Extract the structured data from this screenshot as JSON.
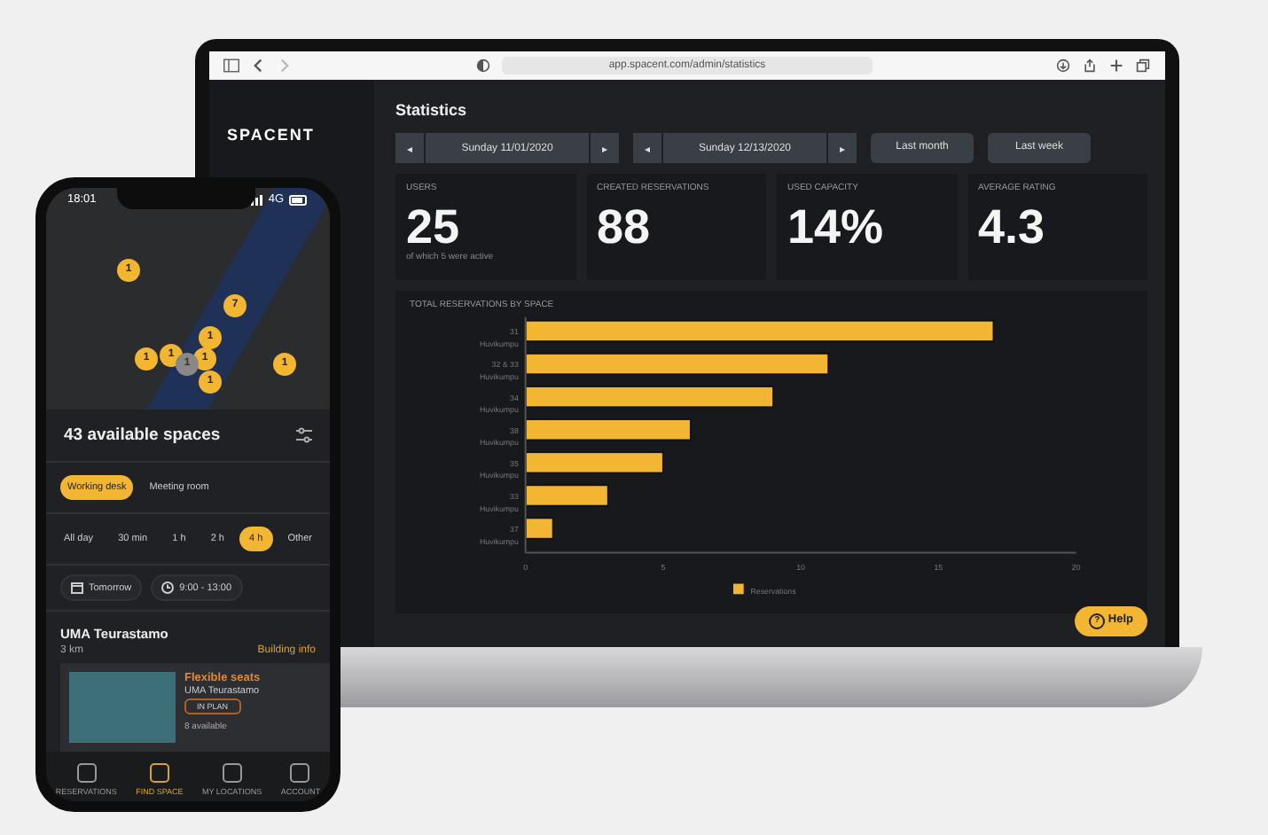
{
  "browser": {
    "url": "app.spacent.com/admin/statistics"
  },
  "sidebar": {
    "logo": "SPACENT"
  },
  "page": {
    "title": "Statistics"
  },
  "date_pickers": [
    {
      "label": "Sunday 11/01/2020",
      "prev": "◂",
      "next": "▸"
    },
    {
      "label": "Sunday 12/13/2020",
      "prev": "◂",
      "next": "▸"
    }
  ],
  "quick_ranges": [
    "Last month",
    "Last week"
  ],
  "stats": [
    {
      "label": "USERS",
      "value": "25",
      "note": "of which 5 were active"
    },
    {
      "label": "CREATED RESERVATIONS",
      "value": "88"
    },
    {
      "label": "USED CAPACITY",
      "value": "14%"
    },
    {
      "label": "AVERAGE RATING",
      "value": "4.3"
    }
  ],
  "chart_panel": {
    "chart_data": {
      "type": "bar",
      "orientation": "horizontal",
      "title": "TOTAL RESERVATIONS BY SPACE",
      "categories": [
        "31 Huvikumpu",
        "32 & 33 Huvikumpu",
        "34 Huvikumpu",
        "38 Huvikumpu",
        "35 Huvikumpu",
        "33 Huvikumpu",
        "37 Huvikumpu"
      ],
      "series": [
        {
          "name": "Reservations",
          "color": "#f2b632",
          "values": [
            17,
            11,
            9,
            6,
            5,
            3,
            1
          ]
        }
      ],
      "xlim": [
        0,
        20
      ],
      "xticks": [
        0,
        5,
        10,
        15,
        20
      ]
    }
  },
  "help_button": {
    "label": "Help",
    "icon": "?"
  },
  "phone": {
    "status_bar": {
      "time": "18:01",
      "network": "4G"
    },
    "map_pins": [
      {
        "count": "1",
        "selected": false
      },
      {
        "count": "7",
        "selected": false
      },
      {
        "count": "1",
        "selected": false
      },
      {
        "count": "1",
        "selected": false
      },
      {
        "count": "1",
        "selected": false
      },
      {
        "count": "1",
        "selected": false
      },
      {
        "count": "1",
        "selected": true
      },
      {
        "count": "1",
        "selected": false
      },
      {
        "count": "1",
        "selected": false
      }
    ],
    "heading": "43 available spaces",
    "space_types": [
      {
        "label": "Working desk",
        "selected": true
      },
      {
        "label": "Meeting room",
        "selected": false
      }
    ],
    "durations": [
      {
        "label": "All day",
        "selected": false
      },
      {
        "label": "30 min",
        "selected": false
      },
      {
        "label": "1 h",
        "selected": false
      },
      {
        "label": "2 h",
        "selected": false
      },
      {
        "label": "4 h",
        "selected": true
      },
      {
        "label": "Other",
        "selected": false
      }
    ],
    "day": "Tomorrow",
    "time_range": "9:00 - 13:00",
    "location": {
      "name": "UMA Teurastamo",
      "distance": "3 km",
      "link": "Building info"
    },
    "space_card": {
      "title": "Flexible seats",
      "venue": "UMA Teurastamo",
      "badge": "IN PLAN",
      "availability": "8 available"
    },
    "nav": [
      {
        "label": "RESERVATIONS",
        "selected": false
      },
      {
        "label": "FIND SPACE",
        "selected": true
      },
      {
        "label": "MY LOCATIONS",
        "selected": false
      },
      {
        "label": "ACCOUNT",
        "selected": false
      }
    ]
  }
}
